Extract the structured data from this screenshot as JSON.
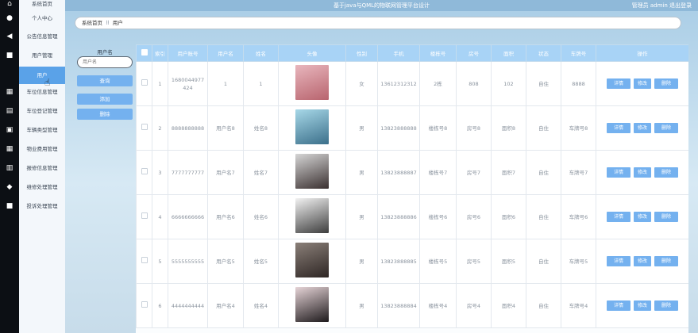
{
  "header": {
    "title": "基于java与QML的物联网管理平台设计",
    "user_text": "管理员 admin  退出登录"
  },
  "sidebar": {
    "items": [
      {
        "label": "系统首页",
        "icon": "home-icon",
        "glyph": "⌂"
      },
      {
        "label": "个人中心",
        "icon": "person-icon",
        "glyph": "●"
      },
      {
        "label": "公告信息管理",
        "icon": "megaphone-icon",
        "glyph": "◀"
      },
      {
        "label": "用户管理",
        "icon": "monitor-icon",
        "glyph": "■"
      },
      {
        "label": "用户",
        "icon": "",
        "glyph": ""
      },
      {
        "label": "车位信息管理",
        "icon": "grid-icon",
        "glyph": "▦"
      },
      {
        "label": "车位登记管理",
        "icon": "doc-icon",
        "glyph": "▤"
      },
      {
        "label": "车辆类型管理",
        "icon": "lock-icon",
        "glyph": "▣"
      },
      {
        "label": "物业费用管理",
        "icon": "apps-icon",
        "glyph": "▦"
      },
      {
        "label": "报修信息管理",
        "icon": "list-icon",
        "glyph": "▥"
      },
      {
        "label": "维修处理管理",
        "icon": "wrench-icon",
        "glyph": "◆"
      },
      {
        "label": "投诉处理管理",
        "icon": "display-icon",
        "glyph": "■"
      }
    ],
    "active_index": 4
  },
  "breadcrumb": {
    "home": "系统首页",
    "separator": "⠿",
    "current": "用户"
  },
  "search": {
    "label": "用户名",
    "placeholder": "用户名",
    "query_button": "查询",
    "add_button": "添加",
    "delete_button": "删除"
  },
  "table": {
    "columns": [
      "索引",
      "用户账号",
      "用户名",
      "姓名",
      "头像",
      "性别",
      "手机",
      "楼栋号",
      "房号",
      "面积",
      "状态",
      "车牌号",
      "操作"
    ],
    "rows": [
      {
        "index": "1",
        "account": "1680044977424",
        "username": "1",
        "name": "1",
        "gender": "女",
        "phone": "13612312312",
        "building": "2栋",
        "room": "808",
        "area": "102",
        "status": "自住",
        "plate": "8888",
        "avatar_colors": [
          "#e8b6bd",
          "#b8646e"
        ]
      },
      {
        "index": "2",
        "account": "8888888888",
        "username": "用户名8",
        "name": "姓名8",
        "gender": "男",
        "phone": "13823888888",
        "building": "楼栋号8",
        "room": "房号8",
        "area": "面积8",
        "status": "自住",
        "plate": "车牌号8",
        "avatar_colors": [
          "#a7d8e8",
          "#3b6f8a"
        ]
      },
      {
        "index": "3",
        "account": "7777777777",
        "username": "用户名7",
        "name": "姓名7",
        "gender": "男",
        "phone": "13823888887",
        "building": "楼栋号7",
        "room": "房号7",
        "area": "面积7",
        "status": "自住",
        "plate": "车牌号7",
        "avatar_colors": [
          "#d6d6d6",
          "#3a3030"
        ]
      },
      {
        "index": "4",
        "account": "6666666666",
        "username": "用户名6",
        "name": "姓名6",
        "gender": "男",
        "phone": "13823888886",
        "building": "楼栋号6",
        "room": "房号6",
        "area": "面积6",
        "status": "自住",
        "plate": "车牌号6",
        "avatar_colors": [
          "#f2f2f2",
          "#3d3d3d"
        ]
      },
      {
        "index": "5",
        "account": "5555555555",
        "username": "用户名5",
        "name": "姓名5",
        "gender": "男",
        "phone": "13823888885",
        "building": "楼栋号5",
        "room": "房号5",
        "area": "面积5",
        "status": "自住",
        "plate": "车牌号5",
        "avatar_colors": [
          "#8a7f78",
          "#2e2624"
        ]
      },
      {
        "index": "6",
        "account": "4444444444",
        "username": "用户名4",
        "name": "姓名4",
        "gender": "男",
        "phone": "13823888884",
        "building": "楼栋号4",
        "room": "房号4",
        "area": "面积4",
        "status": "自住",
        "plate": "车牌号4",
        "avatar_colors": [
          "#e6d4d7",
          "#1e1a1c"
        ]
      }
    ],
    "actions": {
      "detail": "详情",
      "edit": "修改",
      "delete": "删除"
    }
  }
}
